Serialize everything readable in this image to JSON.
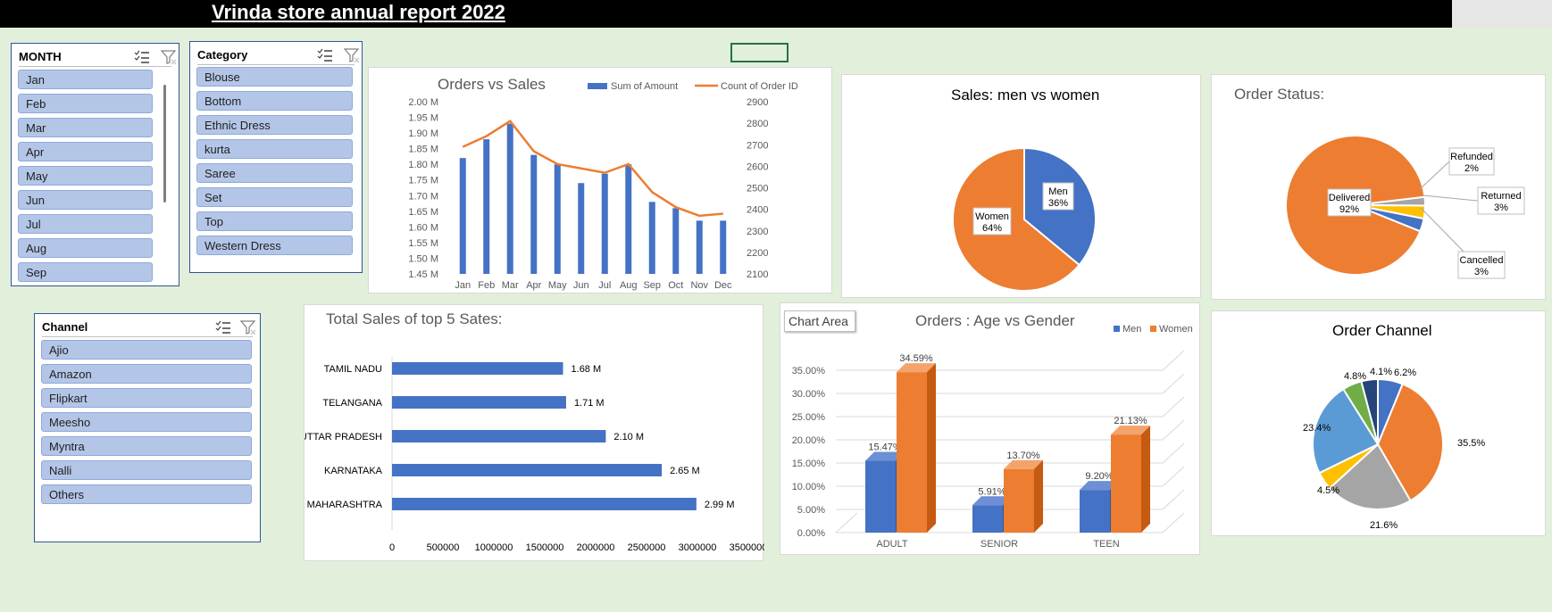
{
  "header": {
    "title": "Vrinda store annual report 2022"
  },
  "slicers": {
    "month": {
      "title": "MONTH",
      "items": [
        "Jan",
        "Feb",
        "Mar",
        "Apr",
        "May",
        "Jun",
        "Jul",
        "Aug",
        "Sep"
      ]
    },
    "category": {
      "title": "Category",
      "items": [
        "Blouse",
        "Bottom",
        "Ethnic Dress",
        "kurta",
        "Saree",
        "Set",
        "Top",
        "Western Dress"
      ]
    },
    "channel": {
      "title": "Channel",
      "items": [
        "Ajio",
        "Amazon",
        "Flipkart",
        "Meesho",
        "Myntra",
        "Nalli",
        "Others"
      ]
    }
  },
  "chart_area_tag": "Chart Area",
  "colors": {
    "blue": "#4472c4",
    "orange": "#ed7d31",
    "gray": "#a5a5a5",
    "yellow": "#ffc000",
    "lightblue": "#5b9bd5",
    "green": "#70ad47",
    "navy": "#264478"
  },
  "chart_data": [
    {
      "id": "orders_vs_sales",
      "type": "bar",
      "title": "Orders vs Sales",
      "categories": [
        "Jan",
        "Feb",
        "Mar",
        "Apr",
        "May",
        "Jun",
        "Jul",
        "Aug",
        "Sep",
        "Oct",
        "Nov",
        "Dec"
      ],
      "series": [
        {
          "name": "Sum of Amount",
          "kind": "bar",
          "axis": "left",
          "values": [
            1.82,
            1.88,
            1.93,
            1.83,
            1.8,
            1.74,
            1.77,
            1.8,
            1.68,
            1.66,
            1.62,
            1.62
          ]
        },
        {
          "name": "Count of Order ID",
          "kind": "line",
          "axis": "right",
          "values": [
            2690,
            2740,
            2810,
            2670,
            2610,
            2590,
            2570,
            2610,
            2480,
            2410,
            2370,
            2380
          ]
        }
      ],
      "ylim": [
        1.45,
        2.0
      ],
      "y_ticks": [
        "1.45 M",
        "1.50 M",
        "1.55 M",
        "1.60 M",
        "1.65 M",
        "1.70 M",
        "1.75 M",
        "1.80 M",
        "1.85 M",
        "1.90 M",
        "1.95 M",
        "2.00 M"
      ],
      "y2lim": [
        2100,
        2900
      ],
      "y2_ticks": [
        "2100",
        "2200",
        "2300",
        "2400",
        "2500",
        "2600",
        "2700",
        "2800",
        "2900"
      ],
      "legend": "top"
    },
    {
      "id": "sales_gender",
      "type": "pie",
      "title": "Sales: men vs women",
      "slices": [
        {
          "name": "Men",
          "value": 36,
          "label": "36%"
        },
        {
          "name": "Women",
          "value": 64,
          "label": "64%"
        }
      ]
    },
    {
      "id": "order_status",
      "type": "pie",
      "title": "Order Status:",
      "slices": [
        {
          "name": "Delivered",
          "value": 92,
          "label": "92%"
        },
        {
          "name": "Refunded",
          "value": 2,
          "label": "2%"
        },
        {
          "name": "Returned",
          "value": 3,
          "label": "3%"
        },
        {
          "name": "Cancelled",
          "value": 3,
          "label": "3%"
        }
      ]
    },
    {
      "id": "top_states",
      "type": "bar",
      "orientation": "horizontal",
      "title": "Total Sales of top 5 Sates:",
      "categories": [
        "TAMIL NADU",
        "TELANGANA",
        "UTTAR PRADESH",
        "KARNATAKA",
        "MAHARASHTRA"
      ],
      "values": [
        1680000,
        1710000,
        2100000,
        2650000,
        2990000
      ],
      "value_labels": [
        "1.68 M",
        "1.71 M",
        "2.10 M",
        "2.65 M",
        "2.99 M"
      ],
      "xlim": [
        0,
        3500000
      ],
      "x_ticks": [
        "0",
        "500000",
        "1000000",
        "1500000",
        "2000000",
        "2500000",
        "3000000",
        "3500000"
      ]
    },
    {
      "id": "age_gender",
      "type": "bar",
      "title": "Orders : Age vs Gender",
      "categories": [
        "ADULT",
        "SENIOR",
        "TEEN"
      ],
      "series": [
        {
          "name": "Men",
          "values": [
            15.47,
            5.91,
            9.2
          ],
          "labels": [
            "15.47%",
            "5.91%",
            "9.20%"
          ]
        },
        {
          "name": "Women",
          "values": [
            34.59,
            13.7,
            21.13
          ],
          "labels": [
            "34.59%",
            "13.70%",
            "21.13%"
          ]
        }
      ],
      "ylim": [
        0,
        35
      ],
      "y_ticks": [
        "0.00%",
        "5.00%",
        "10.00%",
        "15.00%",
        "20.00%",
        "25.00%",
        "30.00%",
        "35.00%"
      ],
      "legend": "top-right"
    },
    {
      "id": "order_channel",
      "type": "pie",
      "title": "Order Channel",
      "slices": [
        {
          "value": 6.2,
          "label": "6.2%"
        },
        {
          "value": 35.5,
          "label": "35.5%"
        },
        {
          "value": 21.6,
          "label": "21.6%"
        },
        {
          "value": 4.5,
          "label": "4.5%"
        },
        {
          "value": 23.4,
          "label": "23.4%"
        },
        {
          "value": 4.8,
          "label": "4.8%"
        },
        {
          "value": 4.1,
          "label": "4.1%"
        }
      ]
    }
  ]
}
